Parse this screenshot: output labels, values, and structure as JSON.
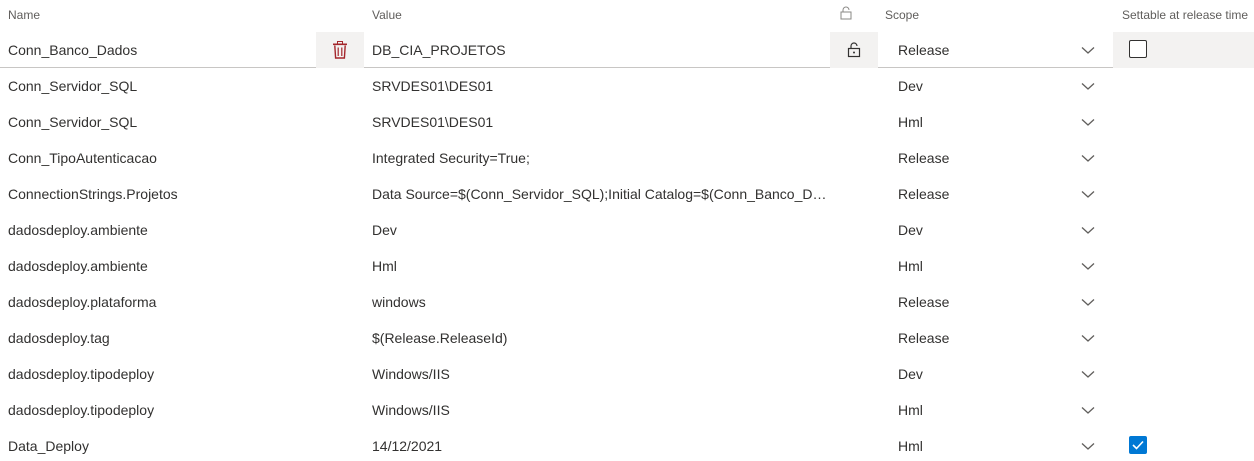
{
  "header": {
    "name": "Name",
    "value": "Value",
    "scope": "Scope",
    "settable": "Settable at release time"
  },
  "rows": [
    {
      "name": "Conn_Banco_Dados",
      "value": "DB_CIA_PROJETOS",
      "scope": "Release",
      "settable": false,
      "selected": true
    },
    {
      "name": "Conn_Servidor_SQL",
      "value": "SRVDES01\\DES01",
      "scope": "Dev"
    },
    {
      "name": "Conn_Servidor_SQL",
      "value": "SRVDES01\\DES01",
      "scope": "Hml"
    },
    {
      "name": "Conn_TipoAutenticacao",
      "value": "Integrated Security=True;",
      "scope": "Release"
    },
    {
      "name": "ConnectionStrings.Projetos",
      "value": "Data Source=$(Conn_Servidor_SQL);Initial Catalog=$(Conn_Banco_Dad...",
      "scope": "Release"
    },
    {
      "name": "dadosdeploy.ambiente",
      "value": "Dev",
      "scope": "Dev"
    },
    {
      "name": "dadosdeploy.ambiente",
      "value": "Hml",
      "scope": "Hml"
    },
    {
      "name": "dadosdeploy.plataforma",
      "value": "windows",
      "scope": "Release"
    },
    {
      "name": "dadosdeploy.tag",
      "value": "$(Release.ReleaseId)",
      "scope": "Release"
    },
    {
      "name": "dadosdeploy.tipodeploy",
      "value": "Windows/IIS",
      "scope": "Dev"
    },
    {
      "name": "dadosdeploy.tipodeploy",
      "value": "Windows/IIS",
      "scope": "Hml"
    },
    {
      "name": "Data_Deploy",
      "value": "14/12/2021",
      "scope": "Hml",
      "settable": true
    }
  ],
  "colors": {
    "accent": "#0078d4",
    "trash": "#a4262c",
    "selected_row": "#f3f2f1"
  },
  "icons": {
    "header_lock": "lock-icon",
    "row_lock": "lock-icon",
    "delete": "trash-icon",
    "scope_dropdown": "chevron-down-icon",
    "checked": "checkmark-icon"
  }
}
